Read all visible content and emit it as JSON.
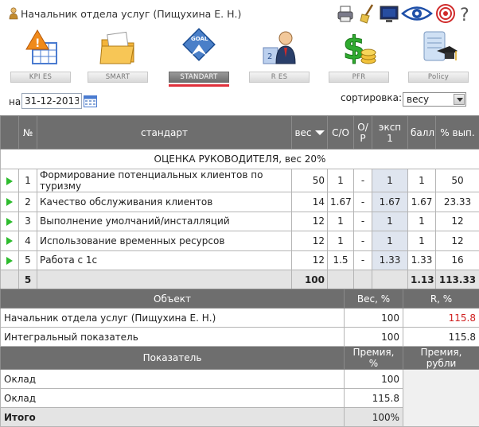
{
  "header": {
    "title": "Начальник отдела услуг  (Пищухина Е. Н.)"
  },
  "nav": {
    "items": [
      {
        "label": "KPI  ES",
        "icon": "warning-grid-icon"
      },
      {
        "label": "SMART",
        "icon": "folder-icon"
      },
      {
        "label": "STANDART",
        "icon": "goal-diamond-icon",
        "active": true
      },
      {
        "label": "R  ES",
        "icon": "person-podium-icon"
      },
      {
        "label": "PFR",
        "icon": "dollar-coins-icon"
      },
      {
        "label": "Policy",
        "icon": "scroll-graduation-icon"
      }
    ]
  },
  "controls": {
    "date_label": "на",
    "date_value": "31-12-2013",
    "sort_label": "сортировка:",
    "sort_value": "весу"
  },
  "main_table": {
    "headers": {
      "num": "№",
      "standard": "стандарт",
      "weight": "вес",
      "co": "С/О",
      "op": "О/Р",
      "exp1": "эксп 1",
      "score": "балл",
      "pct": "% вып."
    },
    "section": "ОЦЕНКА РУКОВОДИТЕЛЯ, вес 20%",
    "rows": [
      {
        "n": "1",
        "name": "Формирование потенциальных клиентов по туризму",
        "weight": "50",
        "co": "1",
        "op": "-",
        "exp1": "1",
        "score": "1",
        "pct": "50"
      },
      {
        "n": "2",
        "name": "Качество обслуживания клиентов",
        "weight": "14",
        "co": "1.67",
        "op": "-",
        "exp1": "1.67",
        "score": "1.67",
        "pct": "23.33"
      },
      {
        "n": "3",
        "name": "Выполнение умолчаний/инсталляций",
        "weight": "12",
        "co": "1",
        "op": "-",
        "exp1": "1",
        "score": "1",
        "pct": "12"
      },
      {
        "n": "4",
        "name": "Использование временных ресурсов",
        "weight": "12",
        "co": "1",
        "op": "-",
        "exp1": "1",
        "score": "1",
        "pct": "12"
      },
      {
        "n": "5",
        "name": "Работа с 1с",
        "weight": "12",
        "co": "1.5",
        "op": "-",
        "exp1": "1.33",
        "score": "1.33",
        "pct": "16"
      }
    ],
    "total": {
      "n": "5",
      "weight": "100",
      "score": "1.13",
      "pct": "113.33"
    }
  },
  "object_table": {
    "headers": {
      "object": "Объект",
      "weight": "Вес, %",
      "r": "R, %"
    },
    "rows": [
      {
        "name": "Начальник отдела услуг (Пищухина Е. Н.)",
        "weight": "100",
        "r": "115.8"
      },
      {
        "name": "Интегральный показатель",
        "weight": "100",
        "r": "115.8"
      }
    ]
  },
  "bonus_table": {
    "headers": {
      "indicator": "Показатель",
      "bonus_pct": "Премия, %",
      "bonus_rub": "Премия, рубли"
    },
    "rows": [
      {
        "name": "Оклад",
        "pct": "100"
      },
      {
        "name": "Оклад",
        "pct": "115.8"
      }
    ],
    "total": {
      "name": "Итого",
      "pct": "100%"
    }
  },
  "colors": {
    "header_bg": "#6e6e6e",
    "active_underline": "#e0303b",
    "play_green": "#2dbb2d",
    "highlight_red": "#d01f1f",
    "exp_highlight": "#dfe5ef"
  }
}
